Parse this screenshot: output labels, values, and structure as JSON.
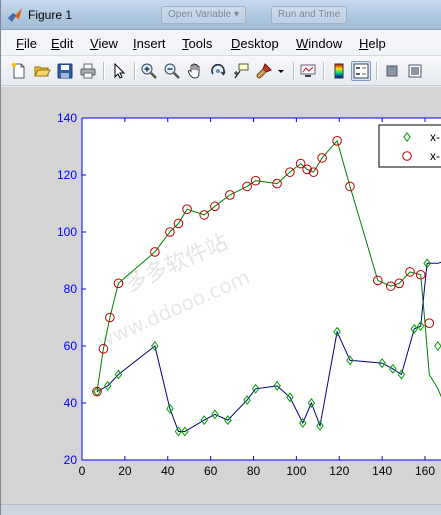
{
  "window": {
    "title": "Figure 1",
    "background_tabs": [
      "Open Variable ▾",
      "Run and Time"
    ]
  },
  "menu": [
    {
      "label": "File",
      "mnemonic": "F",
      "rest": "ile"
    },
    {
      "label": "Edit",
      "mnemonic": "E",
      "rest": "dit"
    },
    {
      "label": "View",
      "mnemonic": "V",
      "rest": "iew"
    },
    {
      "label": "Insert",
      "mnemonic": "I",
      "rest": "nsert"
    },
    {
      "label": "Tools",
      "mnemonic": "T",
      "rest": "ools"
    },
    {
      "label": "Desktop",
      "mnemonic": "D",
      "rest": "esktop"
    },
    {
      "label": "Window",
      "mnemonic": "W",
      "rest": "indow"
    },
    {
      "label": "Help",
      "mnemonic": "H",
      "rest": "elp"
    }
  ],
  "toolbar": [
    "new-figure-icon",
    "open-file-icon",
    "save-icon",
    "print-icon",
    "edit-plot-arrow-icon",
    "zoom-in-icon",
    "zoom-out-icon",
    "pan-hand-icon",
    "rotate-3d-icon",
    "data-cursor-icon",
    "brush-icon",
    "brush-dropdown-icon",
    "link-plot-icon",
    "colorbar-icon",
    "legend-icon",
    "hide-plot-tools-icon",
    "show-plot-tools-icon"
  ],
  "watermark": "多多软件站",
  "watermark_url": "www.ddooo.com",
  "colors": {
    "axis": "#0000ff",
    "green_series": "#008000",
    "red_series": "#c00000",
    "blue_series": "#000080"
  },
  "chart_data": {
    "type": "line",
    "xlabel": "",
    "ylabel": "",
    "xlim": [
      0,
      170
    ],
    "ylim": [
      20,
      140
    ],
    "xticks": [
      0,
      20,
      40,
      60,
      80,
      100,
      120,
      140,
      160
    ],
    "yticks": [
      20,
      40,
      60,
      80,
      100,
      120,
      140
    ],
    "grid": false,
    "legend_position": "top-right",
    "legend": [
      "x-",
      "x-"
    ],
    "series": [
      {
        "marker": "diamond",
        "color": "#00a000",
        "x": [
          7,
          12,
          17,
          34,
          41,
          45,
          48,
          57,
          62,
          68,
          77,
          81,
          91,
          97,
          103,
          107,
          111,
          119,
          125,
          140,
          145,
          149,
          155,
          158,
          161,
          166,
          170
        ],
        "y": [
          44,
          46,
          50,
          60,
          38,
          30,
          30,
          34,
          36,
          34,
          41,
          45,
          46,
          42,
          33,
          40,
          32,
          65,
          55,
          54,
          52,
          50,
          66,
          67,
          89,
          60,
          39
        ]
      },
      {
        "marker": "circle",
        "color": "#c00000",
        "x": [
          7,
          10,
          13,
          17,
          34,
          41,
          45,
          49,
          57,
          62,
          69,
          77,
          81,
          91,
          97,
          102,
          105,
          108,
          112,
          119,
          125,
          138,
          144,
          148,
          153,
          158,
          162
        ],
        "y": [
          44,
          59,
          70,
          82,
          93,
          100,
          103,
          108,
          106,
          109,
          113,
          116,
          118,
          117,
          121,
          124,
          122,
          121,
          126,
          132,
          116,
          83,
          81,
          82,
          86,
          85,
          68
        ]
      }
    ],
    "lines": [
      {
        "color": "#008000",
        "x": [
          7,
          10,
          13,
          17,
          34,
          41,
          45,
          49,
          57,
          62,
          69,
          77,
          81,
          91,
          97,
          102,
          105,
          108,
          112,
          119,
          125,
          138,
          144,
          148,
          153,
          158,
          160,
          162,
          166,
          170
        ],
        "y": [
          44,
          59,
          70,
          82,
          93,
          100,
          103,
          108,
          106,
          109,
          113,
          116,
          118,
          117,
          121,
          124,
          122,
          121,
          126,
          132,
          116,
          83,
          81,
          82,
          86,
          85,
          68,
          50,
          45,
          38
        ]
      },
      {
        "color": "#000080",
        "x": [
          7,
          12,
          17,
          34,
          41,
          45,
          48,
          57,
          62,
          68,
          77,
          81,
          91,
          97,
          103,
          107,
          111,
          119,
          125,
          140,
          145,
          149,
          155,
          158,
          160,
          161,
          166,
          170
        ],
        "y": [
          44,
          46,
          50,
          60,
          38,
          30,
          30,
          34,
          36,
          34,
          41,
          45,
          46,
          42,
          33,
          40,
          32,
          65,
          55,
          54,
          52,
          50,
          66,
          67,
          82,
          89,
          89,
          90
        ]
      }
    ]
  }
}
